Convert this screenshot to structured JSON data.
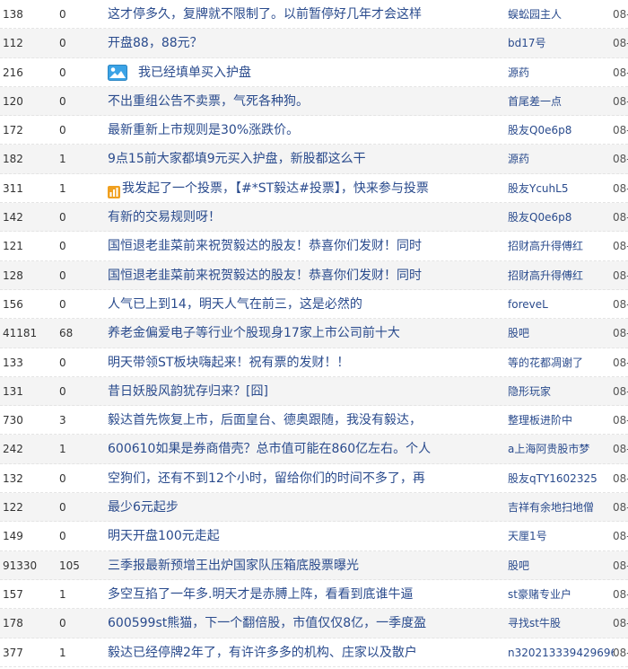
{
  "rows": [
    {
      "read": "138",
      "reply": "0",
      "title": "这才停多久，复牌就不限制了。以前暂停好几年才会这样",
      "author": "蜈蚣园主人",
      "date": "08-"
    },
    {
      "read": "112",
      "reply": "0",
      "title": "开盘88，88元？",
      "author": "bd17号",
      "date": "08-"
    },
    {
      "read": "216",
      "reply": "0",
      "title": "我已经填单买入护盘",
      "author": "源药",
      "date": "08-",
      "icon": "image-icon"
    },
    {
      "read": "120",
      "reply": "0",
      "title": "不出重组公告不卖票，气死各种狗。",
      "author": "首尾差一点",
      "date": "08-"
    },
    {
      "read": "172",
      "reply": "0",
      "title": "最新重新上市规则是30%涨跌价。",
      "author": "股友Q0e6p8",
      "date": "08-"
    },
    {
      "read": "182",
      "reply": "1",
      "title": "9点15前大家都填9元买入护盘，新股都这么干",
      "author": "源药",
      "date": "08-"
    },
    {
      "read": "311",
      "reply": "1",
      "title": "我发起了一个投票，【#*ST毅达#投票】，快来参与投票",
      "author": "股友YcuhL5",
      "date": "08-",
      "icon": "vote-icon"
    },
    {
      "read": "142",
      "reply": "0",
      "title": "有新的交易规则呀！",
      "author": "股友Q0e6p8",
      "date": "08-"
    },
    {
      "read": "121",
      "reply": "0",
      "title": "国恒退老韭菜前来祝贺毅达的股友！恭喜你们发财！同时",
      "author": "招财高升得傅红",
      "date": "08-"
    },
    {
      "read": "128",
      "reply": "0",
      "title": "国恒退老韭菜前来祝贺毅达的股友！恭喜你们发财！同时",
      "author": "招财高升得傅红",
      "date": "08-"
    },
    {
      "read": "156",
      "reply": "0",
      "title": "人气已上到14，明天人气在前三，这是必然的",
      "author": "foreveL",
      "date": "08-"
    },
    {
      "read": "41181",
      "reply": "68",
      "title": "养老金偏爱电子等行业个股现身17家上市公司前十大",
      "author": "股吧",
      "date": "08-"
    },
    {
      "read": "133",
      "reply": "0",
      "title": "明天带领ST板块嗨起来！祝有票的发财！！",
      "author": "等的花都凋谢了",
      "date": "08-"
    },
    {
      "read": "131",
      "reply": "0",
      "title": "昔日妖股风韵犹存归来？[囧]",
      "author": "隐形玩家",
      "date": "08-"
    },
    {
      "read": "730",
      "reply": "3",
      "title": "毅达首先恢复上市，后面皇台、德奥跟随，我没有毅达，",
      "author": "整理板进阶中",
      "date": "08-"
    },
    {
      "read": "242",
      "reply": "1",
      "title": "600610如果是券商借壳？总市值可能在860亿左右。个人",
      "author": "a上海阿贵股市梦",
      "date": "08-"
    },
    {
      "read": "132",
      "reply": "0",
      "title": "空狗们，还有不到12个小时，留给你们的时间不多了，再",
      "author": "股友qTY1602325",
      "date": "08-"
    },
    {
      "read": "122",
      "reply": "0",
      "title": "最少6元起步",
      "author": "吉祥有余地扫地僧",
      "date": "08-"
    },
    {
      "read": "149",
      "reply": "0",
      "title": "明天开盘100元走起",
      "author": "天厘1号",
      "date": "08-"
    },
    {
      "read": "91330",
      "reply": "105",
      "title": "三季报最新预增王出炉国家队压箱底股票曝光",
      "author": "股吧",
      "date": "08-"
    },
    {
      "read": "157",
      "reply": "1",
      "title": "多空互掐了一年多.明天才是赤膊上阵，看看到底谁牛逼",
      "author": "st豪赌专业户",
      "date": "08-"
    },
    {
      "read": "178",
      "reply": "0",
      "title": "600599st熊猫，下一个翻倍股，市值仅仅8亿，一季度盈",
      "author": "寻找st牛股",
      "date": "08-"
    },
    {
      "read": "377",
      "reply": "1",
      "title": "毅达已经停牌2年了，有许许多多的机构、庄家以及散户",
      "author": "n320213339429696",
      "date": "08-"
    }
  ],
  "colors": {
    "link": "#2a4b8d",
    "row_alt": "#f4f4f4",
    "image_icon": "#3ba3e6",
    "vote_icon": "#f0a020"
  }
}
